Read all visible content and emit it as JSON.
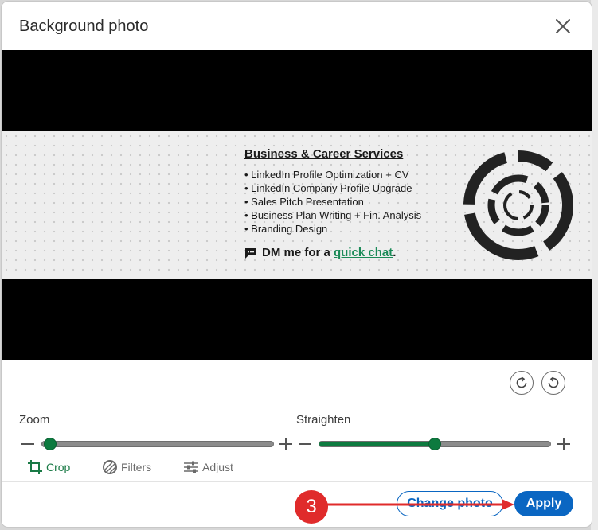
{
  "dialog": {
    "title": "Background photo",
    "close_icon": "close-icon"
  },
  "banner": {
    "heading": "Business & Career Services",
    "items": [
      "• LinkedIn Profile Optimization + CV",
      "• LinkedIn Company Profile Upgrade",
      "• Sales Pitch Presentation",
      "• Business Plan Writing + Fin. Analysis",
      "• Branding Design"
    ],
    "cta_prefix": "DM me for a ",
    "cta_link": "quick chat",
    "cta_suffix": ".",
    "cta_icon": "chat-bubble-icon",
    "link_color": "#1a8a57"
  },
  "rotate": {
    "left_icon": "rotate-left-icon",
    "right_icon": "rotate-right-icon"
  },
  "zoom": {
    "label": "Zoom",
    "decrease_icon": "minus-icon",
    "increase_icon": "plus-icon",
    "value_fraction": 0.0
  },
  "straighten": {
    "label": "Straighten",
    "decrease_icon": "minus-icon",
    "increase_icon": "plus-icon",
    "value_fraction": 0.5
  },
  "tools": [
    {
      "label": "Crop",
      "icon": "crop-icon",
      "active": true
    },
    {
      "label": "Filters",
      "icon": "filters-icon",
      "active": false
    },
    {
      "label": "Adjust",
      "icon": "adjust-icon",
      "active": false
    }
  ],
  "footer": {
    "change_label": "Change photo",
    "apply_label": "Apply"
  },
  "annotation": {
    "number": "3",
    "color": "#e02b2b"
  },
  "colors": {
    "primary": "#0a66c2",
    "accent": "#0d7a3f"
  }
}
